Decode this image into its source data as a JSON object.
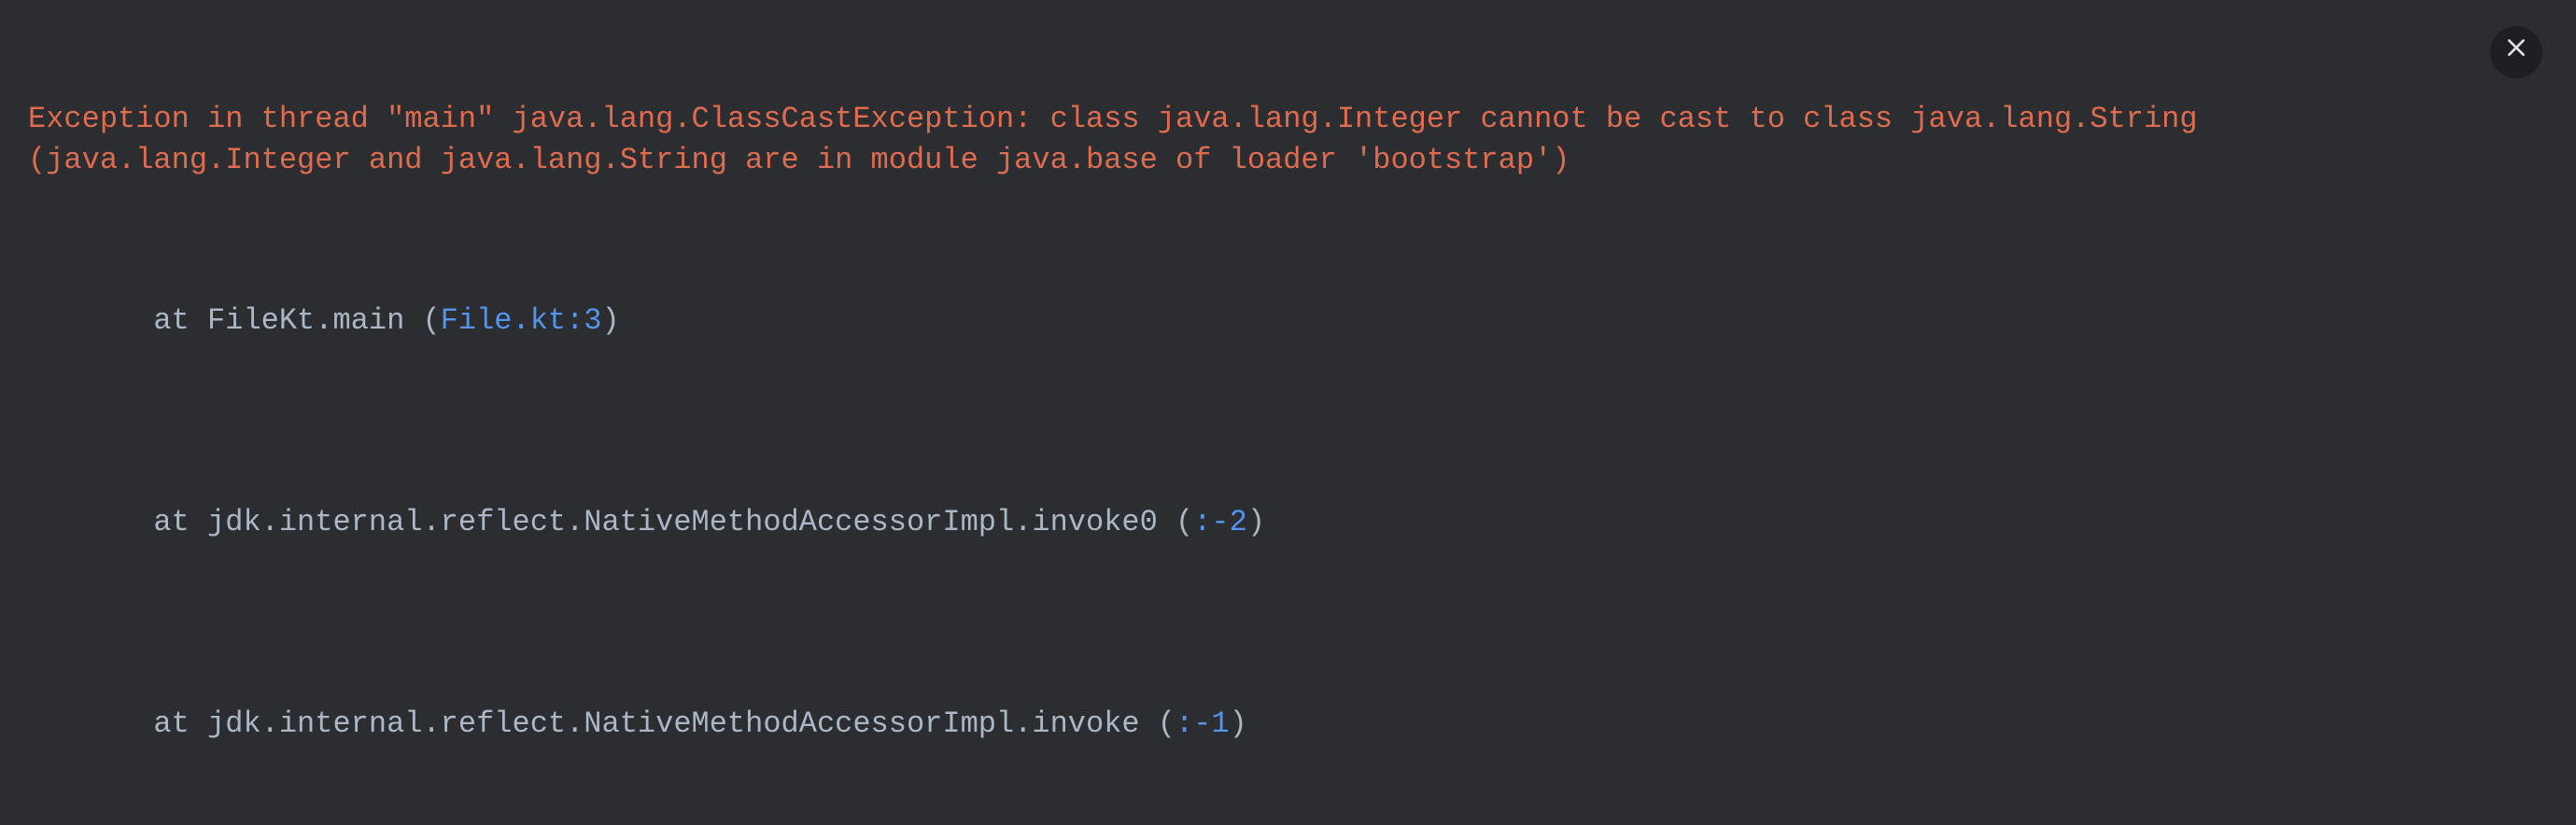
{
  "console": {
    "exception_header": "Exception in thread \"main\" java.lang.ClassCastException: class java.lang.Integer cannot be cast to class java.lang.String (java.lang.Integer and java.lang.String are in module java.base of loader 'bootstrap')",
    "frames": [
      {
        "at": " at ",
        "method": "FileKt.main",
        "paren_open": " (",
        "location": "File.kt:3",
        "paren_close": ")",
        "location_is_link": true
      },
      {
        "at": " at ",
        "method": "jdk.internal.reflect.NativeMethodAccessorImpl.invoke0",
        "paren_open": " (",
        "location": ":-2",
        "paren_close": ")",
        "location_is_link": true
      },
      {
        "at": " at ",
        "method": "jdk.internal.reflect.NativeMethodAccessorImpl.invoke",
        "paren_open": " (",
        "location": ":-1",
        "paren_close": ")",
        "location_is_link": true
      }
    ]
  },
  "icons": {
    "close": "close-icon"
  }
}
